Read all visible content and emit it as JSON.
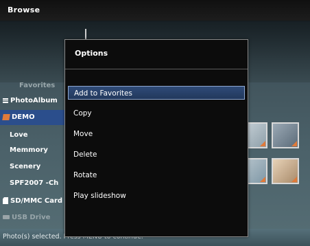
{
  "window": {
    "title": "Browse"
  },
  "sidebar": {
    "items": [
      {
        "label": "Favorites",
        "icon": ""
      },
      {
        "label": "PhotoAlbum",
        "icon": "list-icon"
      },
      {
        "label": "DEMO",
        "icon": "album-icon"
      },
      {
        "label": "Love",
        "icon": ""
      },
      {
        "label": "Memmory",
        "icon": ""
      },
      {
        "label": "Scenery",
        "icon": ""
      },
      {
        "label": "SPF2007 -Ch",
        "icon": ""
      },
      {
        "label": "SD/MMC Card",
        "icon": "card-icon"
      },
      {
        "label": "USB Drive",
        "icon": "usb-icon"
      }
    ]
  },
  "options_menu": {
    "title": "Options",
    "items": [
      "Add to Favorites",
      "Copy",
      "Move",
      "Delete",
      "Rotate",
      "Play slideshow"
    ],
    "selected": "Add to Favorites"
  },
  "status": {
    "text": "Photo(s) selected. Press MENU to continue."
  },
  "colors": {
    "selection": "#2b4e8c",
    "menu_bg": "#0c0c0c",
    "accent_orange": "#e07a3a"
  }
}
